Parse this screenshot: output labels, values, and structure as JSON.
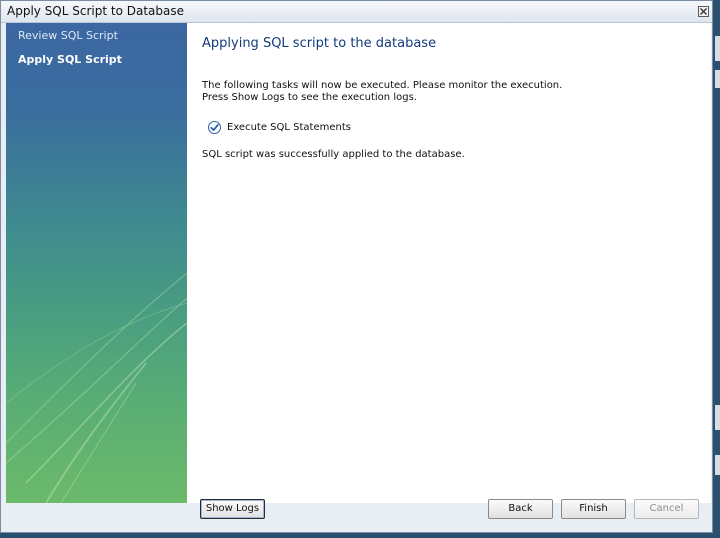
{
  "window": {
    "title": "Apply SQL Script to Database"
  },
  "sidebar": {
    "items": [
      {
        "label": "Review SQL Script",
        "active": false
      },
      {
        "label": "Apply SQL Script",
        "active": true
      }
    ]
  },
  "main": {
    "heading": "Applying SQL script to the database",
    "description_line1": "The following tasks will now be executed. Please monitor the execution.",
    "description_line2": "Press Show Logs to see the execution logs.",
    "task_label": "Execute SQL Statements",
    "status_text": "SQL script was successfully applied to the database."
  },
  "buttons": {
    "show_logs": "Show Logs",
    "back": "Back",
    "finish": "Finish",
    "cancel": "Cancel"
  },
  "icons": {
    "close": "close-icon",
    "task_done": "checkmark-icon"
  },
  "colors": {
    "heading": "#133b7b",
    "checkmark": "#2f5fa8"
  }
}
